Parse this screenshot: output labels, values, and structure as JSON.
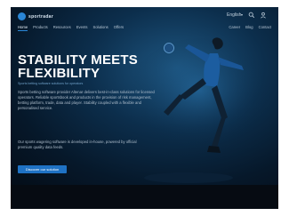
{
  "brand": {
    "name": "sportradar",
    "logo_icon": "logo-circle-icon"
  },
  "topbar": {
    "language": "English",
    "search_icon": "search-icon",
    "user_icon": "user-icon"
  },
  "nav": {
    "items": [
      {
        "label": "Home"
      },
      {
        "label": "Products"
      },
      {
        "label": "Resources"
      },
      {
        "label": "Events"
      },
      {
        "label": "Solutions"
      },
      {
        "label": "Offers"
      }
    ],
    "right": [
      {
        "label": "Career"
      },
      {
        "label": "Blog"
      },
      {
        "label": "Contact"
      }
    ]
  },
  "hero": {
    "headline_line1": "STABILITY MEETS",
    "headline_line2": "FLEXIBILITY",
    "subheading": "Sports betting software solutions for operators",
    "paragraph1": "Sports betting software provider Altenar delivers best-in-class solutions for licensed operators. Reliable sportsbook and products in the provision of risk management, betting platform, trade, data and player. Stability coupled with a flexible and personalised service.",
    "paragraph2": "Our sports wagering software is developed in-house, powered by official premium quality data feeds.",
    "cta_label": "Discover our solution"
  },
  "colors": {
    "accent": "#1f72c4",
    "background": "#05101c",
    "headline": "#ffffff"
  }
}
